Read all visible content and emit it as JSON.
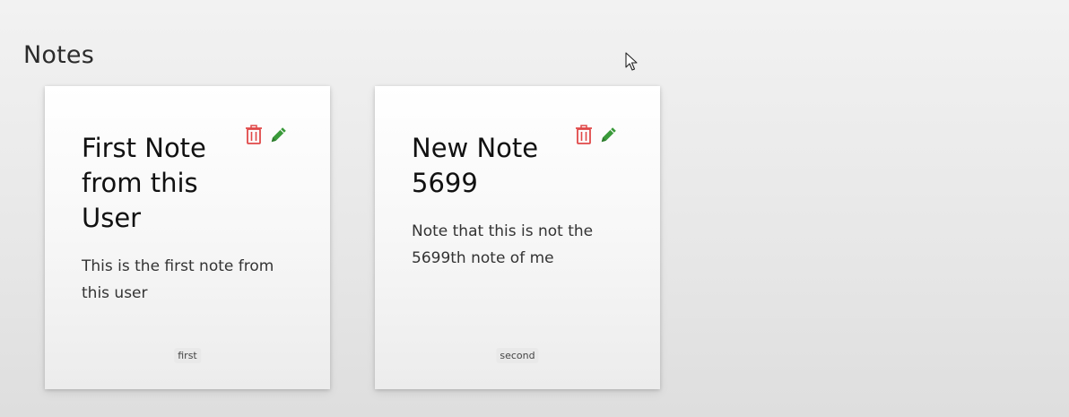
{
  "page": {
    "heading": "Notes"
  },
  "notes": [
    {
      "title": "First Note from this User",
      "body": "This is the first note from this user",
      "tag": "first"
    },
    {
      "title": "New Note 5699",
      "body": "Note that this is not the 5699th note of me",
      "tag": "second"
    }
  ],
  "icons": {
    "delete": "trash-icon",
    "edit": "pencil-icon",
    "cursor": "mouse-pointer-icon"
  },
  "colors": {
    "delete": "#e04848",
    "edit": "#3a9a3a"
  }
}
